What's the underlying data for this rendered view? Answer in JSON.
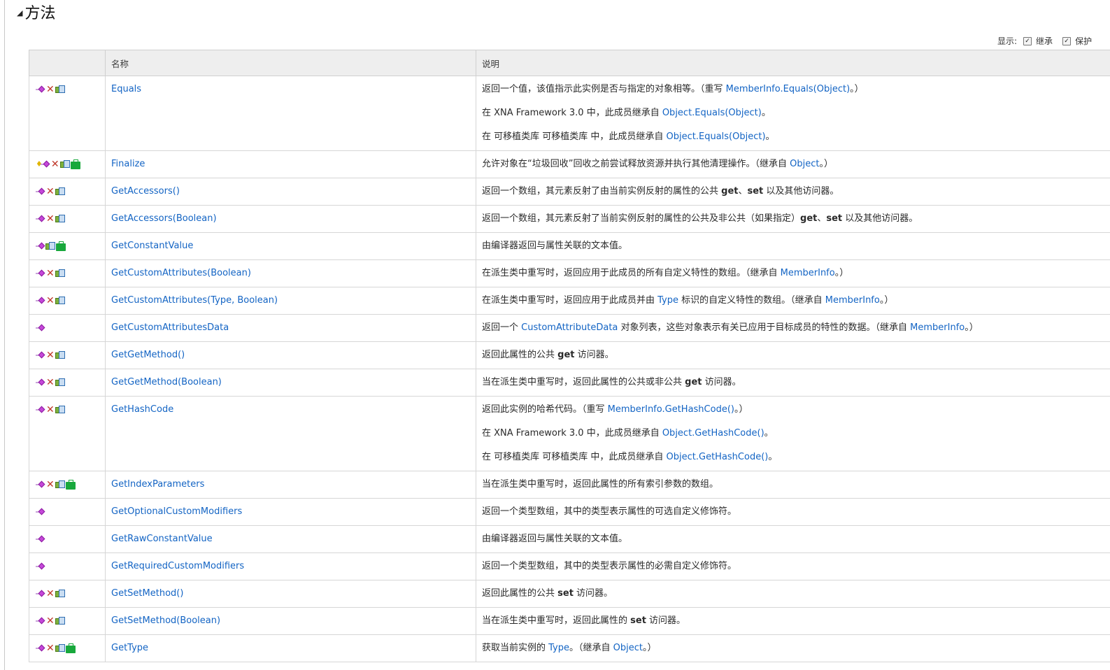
{
  "section": {
    "title": "方法",
    "arrow": "◢"
  },
  "filter": {
    "label": "显示:",
    "items": [
      "继承",
      "保护"
    ]
  },
  "columns": {
    "icons": "",
    "name": "名称",
    "desc": "说明"
  },
  "rows": [
    {
      "icons": [
        "method",
        "x",
        "xna"
      ],
      "name": "Equals",
      "desc": [
        [
          [
            "t",
            "返回一个值，该值指示此实例是否与指定的对象相等。（重写 "
          ],
          [
            "l",
            "MemberInfo.Equals(Object)"
          ],
          [
            "t",
            "。）"
          ]
        ],
        [
          [
            "t",
            "在 XNA Framework 3.0 中，此成员继承自 "
          ],
          [
            "l",
            "Object.Equals(Object)"
          ],
          [
            "t",
            "。"
          ]
        ],
        [
          [
            "t",
            "在 可移植类库 可移植类库 中，此成员继承自 "
          ],
          [
            "l",
            "Object.Equals(Object)"
          ],
          [
            "t",
            "。"
          ]
        ]
      ]
    },
    {
      "icons": [
        "protected",
        "x",
        "xna",
        "bag"
      ],
      "name": "Finalize",
      "desc": [
        [
          [
            "t",
            "允许对象在“垃圾回收”回收之前尝试释放资源并执行其他清理操作。（继承自 "
          ],
          [
            "l",
            "Object"
          ],
          [
            "t",
            "。）"
          ]
        ]
      ]
    },
    {
      "icons": [
        "method",
        "x",
        "xna"
      ],
      "name": "GetAccessors()",
      "desc": [
        [
          [
            "t",
            "返回一个数组，其元素反射了由当前实例反射的属性的公共 "
          ],
          [
            "b",
            "get"
          ],
          [
            "t",
            "、"
          ],
          [
            "b",
            "set"
          ],
          [
            "t",
            " 以及其他访问器。"
          ]
        ]
      ]
    },
    {
      "icons": [
        "method",
        "x",
        "xna"
      ],
      "name": "GetAccessors(Boolean)",
      "desc": [
        [
          [
            "t",
            "返回一个数组，其元素反射了当前实例反射的属性的公共及非公共（如果指定）"
          ],
          [
            "b",
            "get"
          ],
          [
            "t",
            "、"
          ],
          [
            "b",
            "set"
          ],
          [
            "t",
            " 以及其他访问器。"
          ]
        ]
      ]
    },
    {
      "icons": [
        "method",
        "xna",
        "bag"
      ],
      "name": "GetConstantValue",
      "desc": [
        [
          [
            "t",
            "由编译器返回与属性关联的文本值。"
          ]
        ]
      ]
    },
    {
      "icons": [
        "method",
        "x",
        "xna"
      ],
      "name": "GetCustomAttributes(Boolean)",
      "desc": [
        [
          [
            "t",
            "在派生类中重写时，返回应用于此成员的所有自定义特性的数组。（继承自 "
          ],
          [
            "l",
            "MemberInfo"
          ],
          [
            "t",
            "。）"
          ]
        ]
      ]
    },
    {
      "icons": [
        "method",
        "x",
        "xna"
      ],
      "name": "GetCustomAttributes(Type, Boolean)",
      "desc": [
        [
          [
            "t",
            "在派生类中重写时，返回应用于此成员并由 "
          ],
          [
            "l",
            "Type"
          ],
          [
            "t",
            " 标识的自定义特性的数组。（继承自 "
          ],
          [
            "l",
            "MemberInfo"
          ],
          [
            "t",
            "。）"
          ]
        ]
      ]
    },
    {
      "icons": [
        "method"
      ],
      "name": "GetCustomAttributesData",
      "desc": [
        [
          [
            "t",
            "返回一个 "
          ],
          [
            "l",
            "CustomAttributeData"
          ],
          [
            "t",
            " 对象列表，这些对象表示有关已应用于目标成员的特性的数据。（继承自 "
          ],
          [
            "l",
            "MemberInfo"
          ],
          [
            "t",
            "。）"
          ]
        ]
      ]
    },
    {
      "icons": [
        "method",
        "x",
        "xna"
      ],
      "name": "GetGetMethod()",
      "desc": [
        [
          [
            "t",
            "返回此属性的公共 "
          ],
          [
            "b",
            "get"
          ],
          [
            "t",
            " 访问器。"
          ]
        ]
      ]
    },
    {
      "icons": [
        "method",
        "x",
        "xna"
      ],
      "name": "GetGetMethod(Boolean)",
      "desc": [
        [
          [
            "t",
            "当在派生类中重写时，返回此属性的公共或非公共 "
          ],
          [
            "b",
            "get"
          ],
          [
            "t",
            " 访问器。"
          ]
        ]
      ]
    },
    {
      "icons": [
        "method",
        "x",
        "xna"
      ],
      "name": "GetHashCode",
      "desc": [
        [
          [
            "t",
            "返回此实例的哈希代码。（重写 "
          ],
          [
            "l",
            "MemberInfo.GetHashCode()"
          ],
          [
            "t",
            "。）"
          ]
        ],
        [
          [
            "t",
            "在 XNA Framework 3.0 中，此成员继承自 "
          ],
          [
            "l",
            "Object.GetHashCode()"
          ],
          [
            "t",
            "。"
          ]
        ],
        [
          [
            "t",
            "在 可移植类库 可移植类库 中，此成员继承自 "
          ],
          [
            "l",
            "Object.GetHashCode()"
          ],
          [
            "t",
            "。"
          ]
        ]
      ]
    },
    {
      "icons": [
        "method",
        "x",
        "xna",
        "bag"
      ],
      "name": "GetIndexParameters",
      "desc": [
        [
          [
            "t",
            "当在派生类中重写时，返回此属性的所有索引参数的数组。"
          ]
        ]
      ]
    },
    {
      "icons": [
        "method"
      ],
      "name": "GetOptionalCustomModifiers",
      "desc": [
        [
          [
            "t",
            "返回一个类型数组，其中的类型表示属性的可选自定义修饰符。"
          ]
        ]
      ]
    },
    {
      "icons": [
        "method"
      ],
      "name": "GetRawConstantValue",
      "desc": [
        [
          [
            "t",
            "由编译器返回与属性关联的文本值。"
          ]
        ]
      ]
    },
    {
      "icons": [
        "method"
      ],
      "name": "GetRequiredCustomModifiers",
      "desc": [
        [
          [
            "t",
            "返回一个类型数组，其中的类型表示属性的必需自定义修饰符。"
          ]
        ]
      ]
    },
    {
      "icons": [
        "method",
        "x",
        "xna"
      ],
      "name": "GetSetMethod()",
      "desc": [
        [
          [
            "t",
            "返回此属性的公共 "
          ],
          [
            "b",
            "set"
          ],
          [
            "t",
            " 访问器。"
          ]
        ]
      ]
    },
    {
      "icons": [
        "method",
        "x",
        "xna"
      ],
      "name": "GetSetMethod(Boolean)",
      "desc": [
        [
          [
            "t",
            "当在派生类中重写时，返回此属性的 "
          ],
          [
            "b",
            "set"
          ],
          [
            "t",
            " 访问器。"
          ]
        ]
      ]
    },
    {
      "icons": [
        "method",
        "x",
        "xna",
        "bag"
      ],
      "name": "GetType",
      "desc": [
        [
          [
            "t",
            "获取当前实例的 "
          ],
          [
            "l",
            "Type"
          ],
          [
            "t",
            "。（继承自 "
          ],
          [
            "l",
            "Object"
          ],
          [
            "t",
            "。）"
          ]
        ]
      ]
    }
  ]
}
